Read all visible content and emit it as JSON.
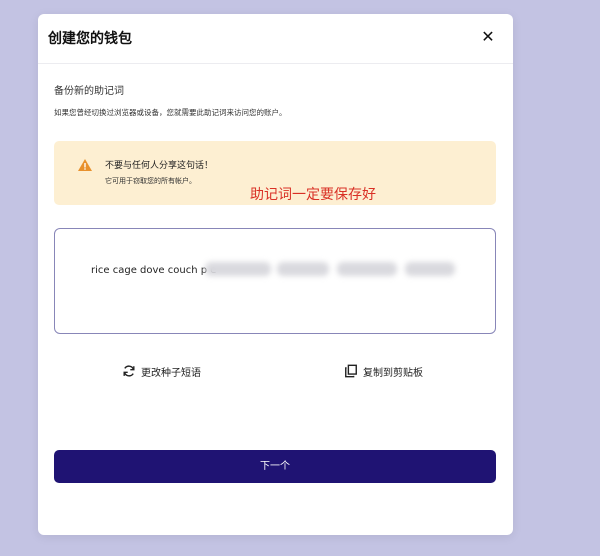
{
  "modal": {
    "title": "创建您的钱包",
    "close_label": "✕"
  },
  "backup": {
    "title": "备份新的助记词",
    "description": "如果您曾经切换过浏览器或设备，您就需要此助记词来访问您的账户。"
  },
  "warning": {
    "icon": "warning-triangle-icon",
    "title": "不要与任何人分享这句话！",
    "subtitle": "它可用于窃取您的所有帐户。",
    "color": "#e8912d"
  },
  "annotation": {
    "text": "助记词一定要保存好",
    "color": "#d93025"
  },
  "seed_phrase": {
    "visible_text": "rice cage dove couch p                                                          e"
  },
  "actions": {
    "refresh_label": "更改种子短语",
    "copy_label": "复制到剪贴板"
  },
  "next_button": {
    "label": "下一个",
    "color": "#1f1373"
  }
}
